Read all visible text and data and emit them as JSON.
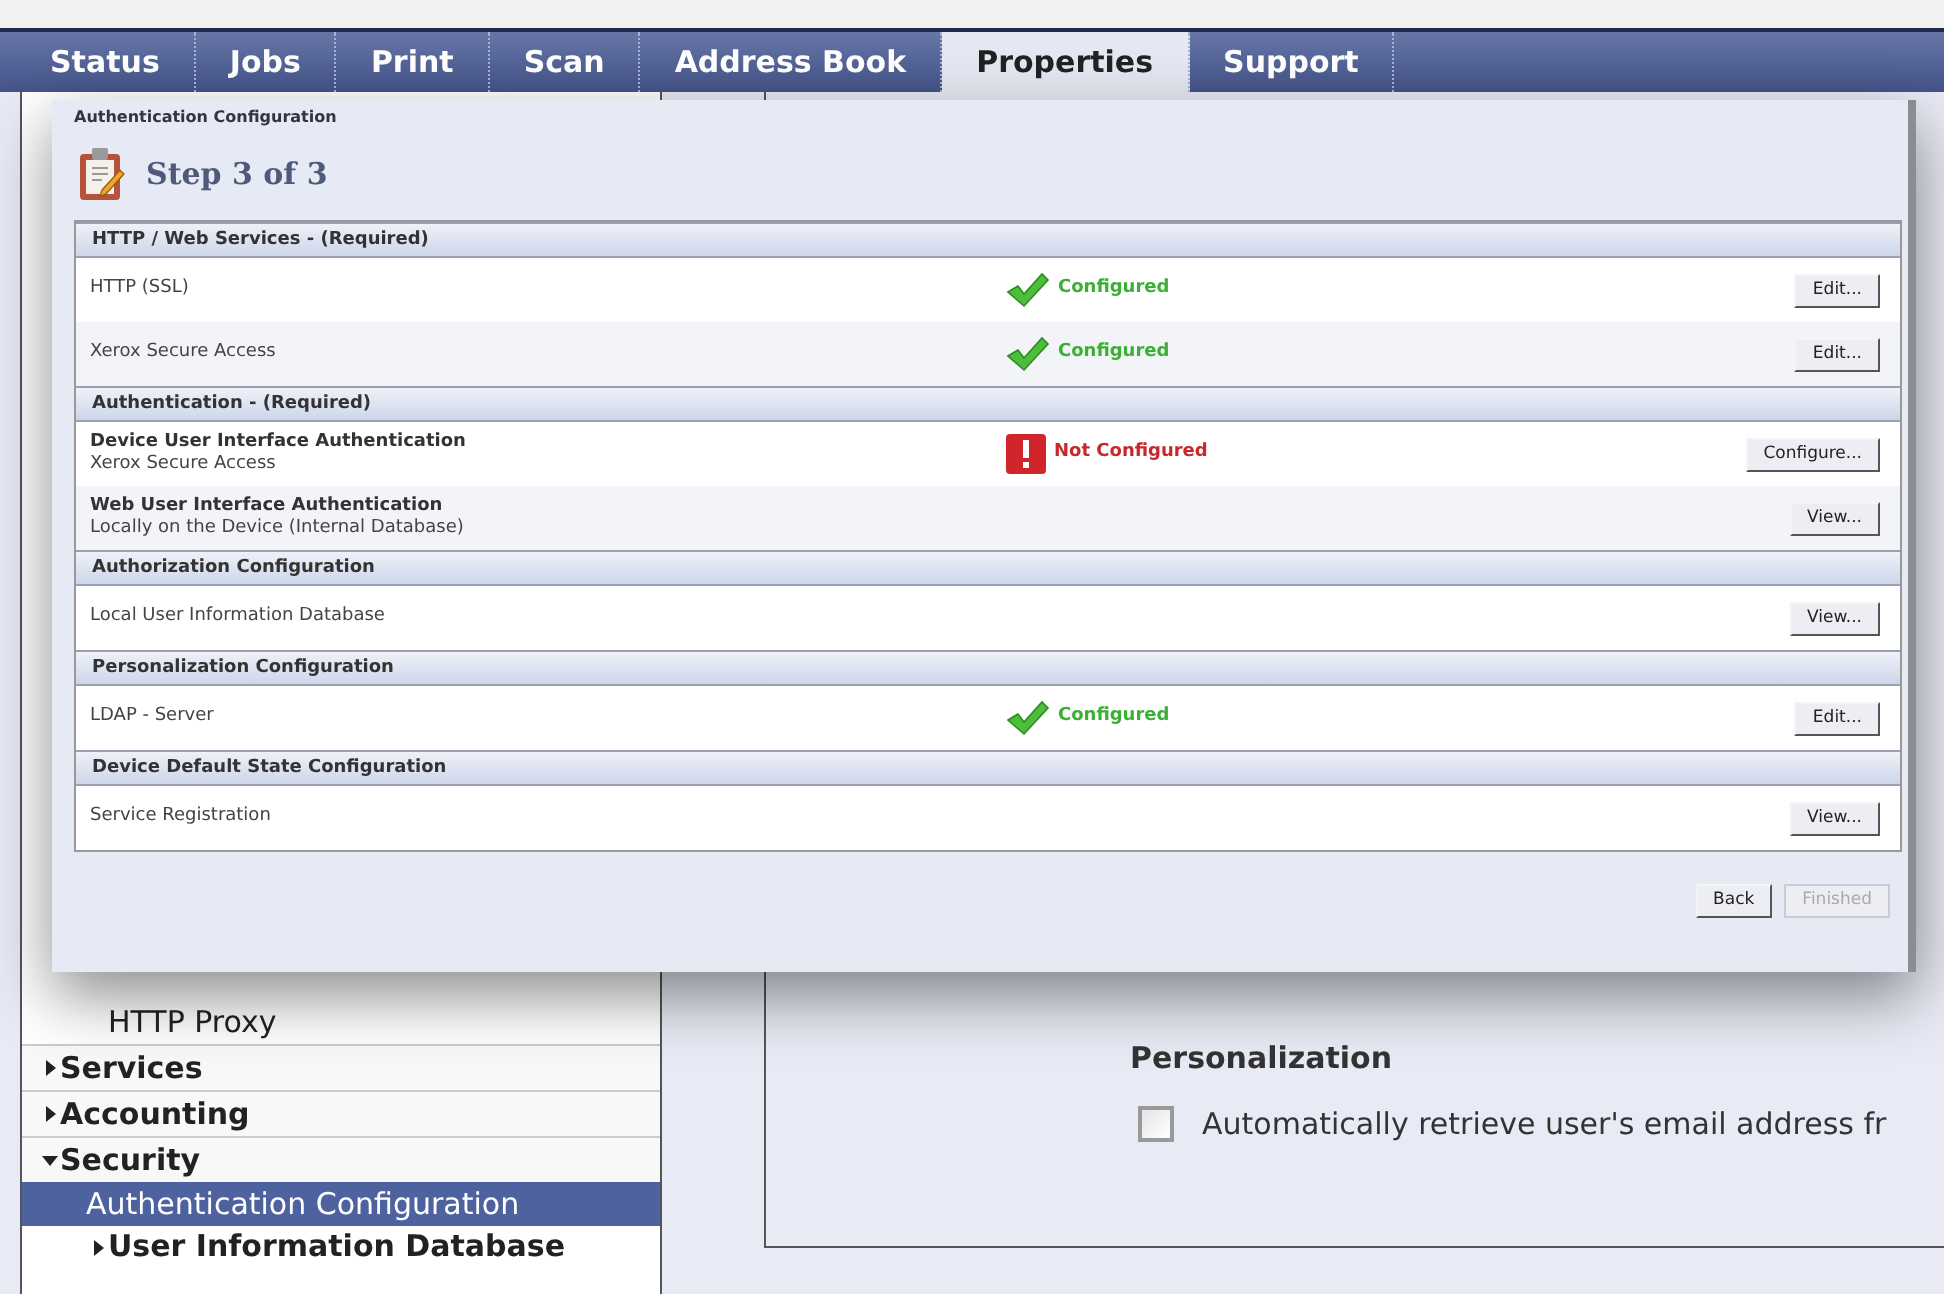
{
  "nav_tabs": [
    {
      "label": "Status",
      "selected": false
    },
    {
      "label": "Jobs",
      "selected": false
    },
    {
      "label": "Print",
      "selected": false
    },
    {
      "label": "Scan",
      "selected": false
    },
    {
      "label": "Address Book",
      "selected": false
    },
    {
      "label": "Properties",
      "selected": true
    },
    {
      "label": "Support",
      "selected": false
    }
  ],
  "sidebar": {
    "partial_items": [
      {
        "label": "HTTP Proxy",
        "selected": false
      }
    ],
    "items": [
      {
        "label": "Services",
        "expanded": false,
        "selected": false
      },
      {
        "label": "Accounting",
        "expanded": false,
        "selected": false
      },
      {
        "label": "Security",
        "expanded": true,
        "selected": false,
        "children": [
          {
            "label": "Authentication Configuration",
            "kind": "link",
            "selected": true
          },
          {
            "label": "User Information Database",
            "kind": "group",
            "expanded": false,
            "selected": false
          }
        ]
      }
    ]
  },
  "content": {
    "heading": "Personalization",
    "checkbox": {
      "label": "Automatically retrieve user's email address fr",
      "checked": false
    }
  },
  "dialog": {
    "title": "Authentication Configuration",
    "step": "Step 3 of 3",
    "sections": [
      {
        "title": "HTTP / Web Services - (Required)",
        "rows": [
          {
            "label": "HTTP (SSL)",
            "status": {
              "kind": "configured",
              "text": "Configured"
            },
            "button": "Edit..."
          },
          {
            "label": "Xerox Secure Access",
            "status": {
              "kind": "configured",
              "text": "Configured"
            },
            "button": "Edit..."
          }
        ]
      },
      {
        "title": "Authentication - (Required)",
        "rows": [
          {
            "label": "Device User Interface Authentication",
            "sublabel": "Xerox Secure Access",
            "status": {
              "kind": "not_configured",
              "text": "Not Configured"
            },
            "button": "Configure..."
          },
          {
            "label": "Web User Interface Authentication",
            "sublabel": "Locally on the Device (Internal Database)",
            "button": "View..."
          }
        ]
      },
      {
        "title": "Authorization Configuration",
        "rows": [
          {
            "label": "Local User Information Database",
            "button": "View..."
          }
        ]
      },
      {
        "title": "Personalization Configuration",
        "rows": [
          {
            "label": "LDAP - Server",
            "status": {
              "kind": "configured",
              "text": "Configured"
            },
            "button": "Edit..."
          }
        ]
      },
      {
        "title": "Device Default State Configuration",
        "rows": [
          {
            "label": "Service Registration",
            "button": "View..."
          }
        ]
      }
    ],
    "buttons": [
      {
        "label": "Back",
        "disabled": false
      },
      {
        "label": "Finished",
        "disabled": true
      }
    ]
  }
}
